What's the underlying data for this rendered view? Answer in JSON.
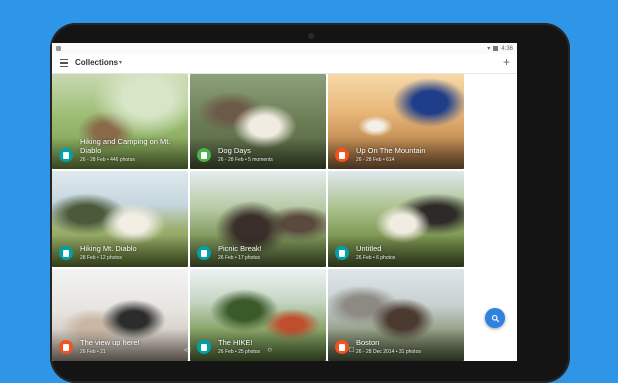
{
  "status": {
    "time": "4:36"
  },
  "appbar": {
    "title": "Collections"
  },
  "collections": [
    {
      "title": "Hiking and Camping on Mt. Diablo",
      "subtitle": "26 - 28 Feb • 446 photos",
      "accent": "#00a0a8"
    },
    {
      "title": "Dog Days",
      "subtitle": "26 - 28 Feb • 5 moments",
      "accent": "#4caf50"
    },
    {
      "title": "Up On The Mountain",
      "subtitle": "26 - 28 Feb • 614",
      "accent": "#f4511e"
    },
    {
      "title": "Hiking Mt. Diablo",
      "subtitle": "28 Feb • 12 photos",
      "accent": "#00a0a8"
    },
    {
      "title": "Picnic Break!",
      "subtitle": "26 Feb • 17 photos",
      "accent": "#00a0a8"
    },
    {
      "title": "Untitled",
      "subtitle": "26 Feb • 6 photos",
      "accent": "#00a0a8"
    },
    {
      "title": "The view up here!",
      "subtitle": "26 Feb • 21",
      "accent": "#f4511e"
    },
    {
      "title": "The HIKE!",
      "subtitle": "26 Feb • 25 photos",
      "accent": "#00a0a8"
    },
    {
      "title": "Boston",
      "subtitle": "26 - 28 Dec 2014 • 31 photos",
      "accent": "#f4511e"
    }
  ],
  "colors": {
    "background": "#2f95e6",
    "fab": "#2f82e0"
  },
  "icons": {
    "menu": "hamburger-icon",
    "add": "plus-icon",
    "search": "search-icon"
  }
}
